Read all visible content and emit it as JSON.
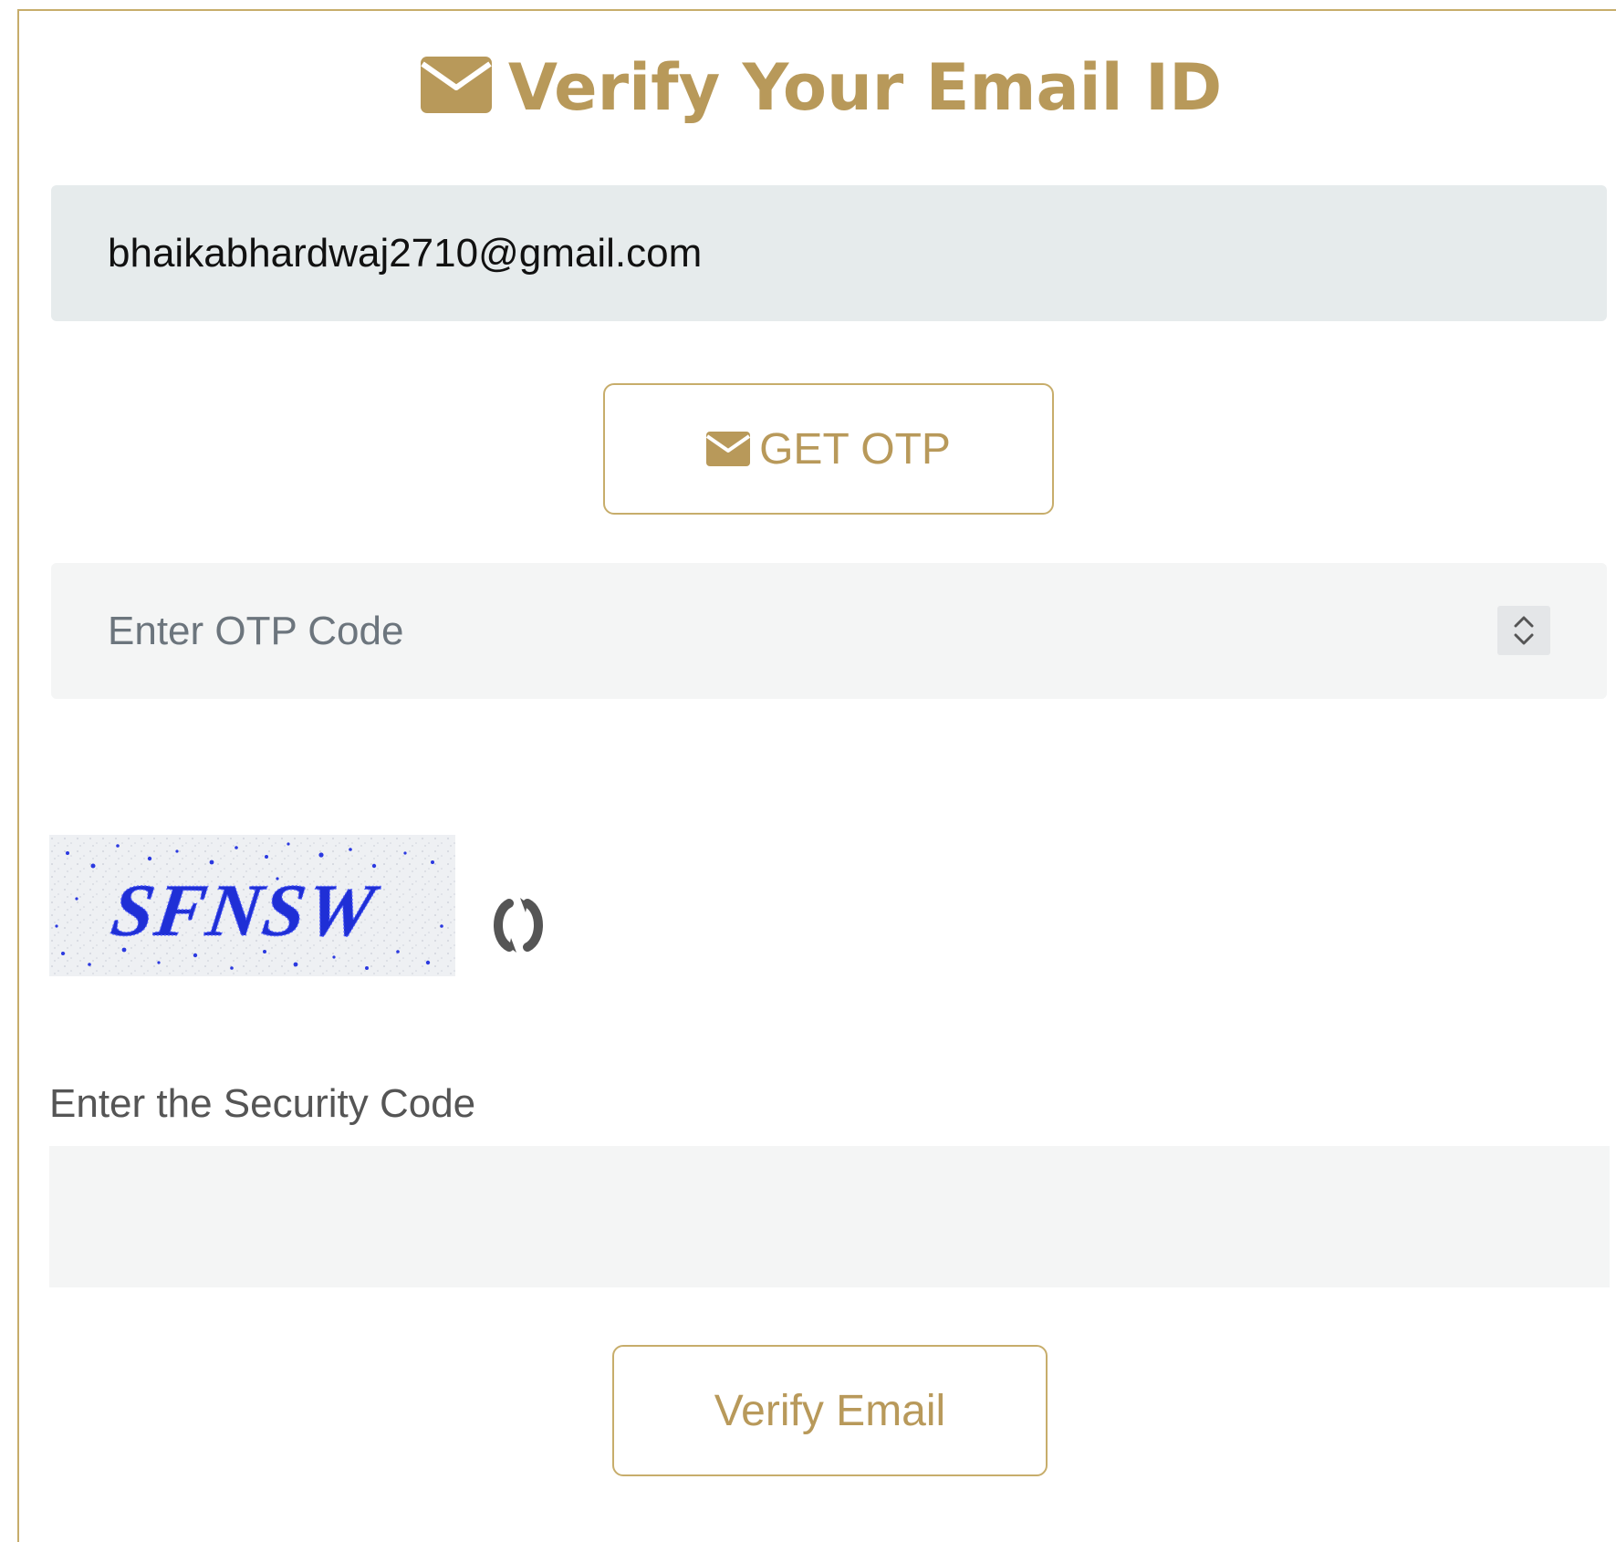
{
  "header": {
    "icon": "envelope-icon",
    "title": "Verify Your Email ID"
  },
  "email": {
    "value": "bhaikabhardwaj2710@gmail.com"
  },
  "otp_button": {
    "icon": "envelope-icon",
    "label": "GET OTP"
  },
  "otp_input": {
    "placeholder": "Enter OTP Code",
    "value": "",
    "stepper_icon": "up-down-chevron-icon"
  },
  "captcha": {
    "text": "SFNSW",
    "refresh_icon": "refresh-icon"
  },
  "security_code": {
    "label": "Enter the Security Code",
    "value": ""
  },
  "verify_button": {
    "label": "Verify Email"
  },
  "colors": {
    "accent": "#b8995a",
    "border": "#c7ad6b",
    "email_bg": "#e6ebec",
    "input_bg": "#f4f5f5",
    "captcha_text": "#1f2fd6"
  }
}
